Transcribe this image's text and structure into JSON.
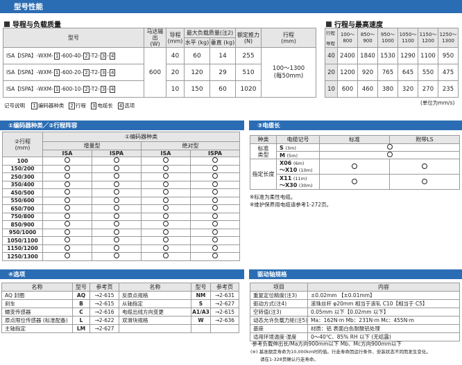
{
  "page": {
    "title": "型号性能"
  },
  "lead_load": {
    "heading": "导程与负载质量",
    "headers": {
      "model": "型号",
      "motor": "马达输出\n(W)",
      "lead": "导程\n(mm)",
      "max_load": "最大负载质量(注2)",
      "horizontal": "水平 (kg)",
      "vertical": "垂直 (kg)",
      "thrust": "额定推力\n(N)",
      "stroke": "行程\n(mm)"
    },
    "rows": [
      {
        "prefix": "ISA【ISPA】-WXM-",
        "b1": "1",
        "mid": "-600-40-",
        "b2": "2",
        "sep": "-T2-",
        "b3": "3",
        "dash": "-",
        "b4": "4",
        "lead": "40",
        "horizontal": "60",
        "vertical": "14",
        "thrust": "255"
      },
      {
        "prefix": "ISA【ISPA】-WXM-",
        "b1": "1",
        "mid": "-600-20-",
        "b2": "2",
        "sep": "-T2-",
        "b3": "3",
        "dash": "-",
        "b4": "4",
        "lead": "20",
        "horizontal": "120",
        "vertical": "29",
        "thrust": "510"
      },
      {
        "prefix": "ISA【ISPA】-WXM-",
        "b1": "1",
        "mid": "-600-10-",
        "b2": "2",
        "sep": "-T2-",
        "b3": "3",
        "dash": "-",
        "b4": "4",
        "lead": "10",
        "horizontal": "150",
        "vertical": "60",
        "thrust": "1020"
      }
    ],
    "motor": "600",
    "stroke_line1": "100～1300",
    "stroke_line2": "(每50mm)"
  },
  "legend": {
    "label": "记号说明",
    "items": [
      {
        "box": "1",
        "text": "编码器种类"
      },
      {
        "box": "2",
        "text": "行程"
      },
      {
        "box": "3",
        "text": "电缆长"
      },
      {
        "box": "4",
        "text": "选项"
      }
    ]
  },
  "speed": {
    "heading": "行程与最高速度",
    "corner_top": "行程",
    "corner_left": "导程",
    "columns": [
      "100～800",
      "850～900",
      "950～1000",
      "1050～1100",
      "1150～1200",
      "1250～1300"
    ],
    "rows": [
      {
        "lead": "40",
        "values": [
          "2400",
          "1840",
          "1530",
          "1290",
          "1100",
          "950"
        ]
      },
      {
        "lead": "20",
        "values": [
          "1200",
          "920",
          "765",
          "645",
          "550",
          "475"
        ]
      },
      {
        "lead": "10",
        "values": [
          "600",
          "460",
          "380",
          "320",
          "270",
          "235"
        ]
      }
    ],
    "unit": "(单位为mm/s)"
  },
  "encoder": {
    "title": "①编码器种类／②行程阵容",
    "stroke_header": "②行程\n(mm)",
    "encoder_header": "①编码器种类",
    "incremental": "增量型",
    "absolute": "绝对型",
    "sub": [
      "ISA",
      "ISPA",
      "ISA",
      "ISPA"
    ],
    "strokes": [
      "100",
      "150/200",
      "250/300",
      "350/400",
      "450/500",
      "550/600",
      "650/700",
      "750/800",
      "850/900",
      "950/1000",
      "1050/1100",
      "1150/1200",
      "1250/1300"
    ]
  },
  "cable": {
    "title": "③电缆长",
    "headers": [
      "种类",
      "电缆记号",
      "标准",
      "附带LS"
    ],
    "standard_type": "标准\n类型",
    "specified": "指定长度",
    "rows": [
      {
        "code": "S",
        "len": "(3m)"
      },
      {
        "code": "M",
        "len": "(5m)"
      },
      {
        "code": "X06",
        "len": "(6m)",
        "code2": "～X10",
        "len2": "(10m)"
      },
      {
        "code": "X11",
        "len": "(11m)",
        "code2": "～X30",
        "len2": "(30m)"
      }
    ],
    "notes": [
      "※标准为柔性电缆。",
      "※维护保养用电缆请参考1-272页。"
    ]
  },
  "options": {
    "title": "④选项",
    "headers": [
      "名称",
      "型号",
      "参考页"
    ],
    "left": [
      {
        "name": "AQ 封圈",
        "code": "AQ",
        "page": "→2-615"
      },
      {
        "name": "刹车",
        "code": "B",
        "page": "→2-615"
      },
      {
        "name": "蠕变传感器",
        "code": "C",
        "page": "→2-616"
      },
      {
        "name": "原点限位传感器 (标准配备)",
        "code": "L",
        "page": "→2-622"
      },
      {
        "name": "主轴指定",
        "code": "LM",
        "page": "→2-627"
      }
    ],
    "right": [
      {
        "name": "反原点规格",
        "code": "NM",
        "page": "→2-631"
      },
      {
        "name": "从轴指定",
        "code": "S",
        "page": "→2-627"
      },
      {
        "name": "电缆出线方向变更",
        "code": "A1/A3",
        "page": "→2-615"
      },
      {
        "name": "双滑块规格",
        "code": "W",
        "page": "→2-636"
      }
    ]
  },
  "drive": {
    "title": "驱动轴规格",
    "headers": [
      "项目",
      "内容"
    ],
    "rows": [
      {
        "item": "重复定位精度(注3)",
        "content": "±0.02mm 【±0.01mm】"
      },
      {
        "item": "驱动方式(注4)",
        "content": "滚珠丝杆 φ20mm  相当于滚轧 C10【相当于 C5】"
      },
      {
        "item": "空转值(注3)",
        "content": "0.05mm 以下【0.02mm 以下】"
      },
      {
        "item": "动态允许负载力矩(注5)",
        "content": "Ma：162N·m  Mb：231N·m  Mc：455N·m"
      },
      {
        "item": "基座",
        "content": "材质：铝  表面白色耐酸铝处理"
      },
      {
        "item": "适用环境温度·湿度",
        "content": "0～40℃、85% RH 以下 (无结露)"
      }
    ],
    "notes": [
      "·参考负载伸出长/Ma方向900mm以下  Mb、Mc方向900mm以下",
      "(※) 基准额定寿命为10,000km时的值。行走寿命因运行条件、安装状态不同而发生变化。",
      "请在1-328页确认行走寿命。"
    ]
  },
  "colors": {
    "brand_blue": "#2b6db4",
    "header_gray": "#e6e6e6",
    "border": "#9a9a9a"
  }
}
